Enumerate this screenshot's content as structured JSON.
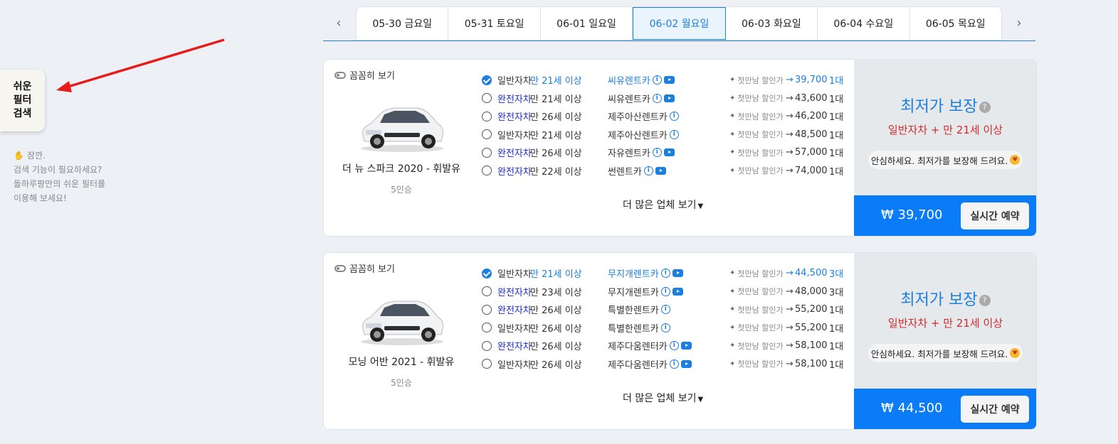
{
  "filter": {
    "label_lines": [
      "쉬운",
      "필터",
      "검색"
    ]
  },
  "hint": {
    "icon": "waving-hand-icon",
    "title": "잠깐.",
    "lines": [
      "검색 기능이 필요하세요?",
      "돌하루팡만의 쉬운 필터를",
      "이용해 보세요!"
    ]
  },
  "dates": {
    "prev_icon": "chevron-left-icon",
    "next_icon": "chevron-right-icon",
    "tabs": [
      "05-30 금요일",
      "05-31 토요일",
      "06-01 일요일",
      "06-02 월요일",
      "06-03 화요일",
      "06-04 수요일",
      "06-05 목요일"
    ],
    "active_index": 3
  },
  "common": {
    "detail_toggle": "꼼꼼히 보기",
    "more_label": "더 많은 업체 보기",
    "discount_label": "첫만남 할인가",
    "guarantee_title": "최저가 보장",
    "reassure_text": "안심하세요. 최저가를 보장해 드려요.",
    "book_label": "실시간 예약",
    "accent_color": "#0a7cf7",
    "red_color": "#d32b2b"
  },
  "cards": [
    {
      "car_name": "더 뉴 스파크 2020 - 휘발유",
      "seats": "5인승",
      "guarantee_sub": "일반자차 + 만 21세 이상",
      "price": "₩ 39,700",
      "rows": [
        {
          "insurance": "일반자차",
          "age": "만 21세 이상",
          "company": "씨유렌트카",
          "info": true,
          "video": true,
          "price": "39,700",
          "count": "1대",
          "selected": true
        },
        {
          "insurance": "완전자차",
          "age": "만 21세 이상",
          "company": "씨유렌트카",
          "info": true,
          "video": true,
          "price": "43,600",
          "count": "1대",
          "selected": false
        },
        {
          "insurance": "완전자차",
          "age": "만 26세 이상",
          "company": "제주아산렌트카",
          "info": true,
          "video": false,
          "price": "46,200",
          "count": "1대",
          "selected": false
        },
        {
          "insurance": "일반자차",
          "age": "만 21세 이상",
          "company": "제주아산렌트카",
          "info": true,
          "video": false,
          "price": "48,500",
          "count": "1대",
          "selected": false
        },
        {
          "insurance": "완전자차",
          "age": "만 26세 이상",
          "company": "자유렌트카",
          "info": true,
          "video": true,
          "price": "57,000",
          "count": "1대",
          "selected": false
        },
        {
          "insurance": "완전자차",
          "age": "만 22세 이상",
          "company": "썬렌트카",
          "info": true,
          "video": true,
          "price": "74,000",
          "count": "1대",
          "selected": false
        }
      ]
    },
    {
      "car_name": "모닝 어반 2021 - 휘발유",
      "seats": "5인승",
      "guarantee_sub": "일반자차 + 만 21세 이상",
      "price": "₩ 44,500",
      "rows": [
        {
          "insurance": "일반자차",
          "age": "만 21세 이상",
          "company": "무지개렌트카",
          "info": true,
          "video": true,
          "price": "44,500",
          "count": "3대",
          "selected": true
        },
        {
          "insurance": "완전자차",
          "age": "만 23세 이상",
          "company": "무지개렌트카",
          "info": true,
          "video": true,
          "price": "48,000",
          "count": "3대",
          "selected": false
        },
        {
          "insurance": "완전자차",
          "age": "만 26세 이상",
          "company": "특별한렌트카",
          "info": true,
          "video": false,
          "price": "55,200",
          "count": "1대",
          "selected": false
        },
        {
          "insurance": "일반자차",
          "age": "만 26세 이상",
          "company": "특별한렌트카",
          "info": true,
          "video": false,
          "price": "55,200",
          "count": "1대",
          "selected": false
        },
        {
          "insurance": "완전자차",
          "age": "만 26세 이상",
          "company": "제주다움렌터카",
          "info": true,
          "video": true,
          "price": "58,100",
          "count": "1대",
          "selected": false
        },
        {
          "insurance": "일반자차",
          "age": "만 26세 이상",
          "company": "제주다움렌터카",
          "info": true,
          "video": true,
          "price": "58,100",
          "count": "1대",
          "selected": false
        }
      ]
    }
  ]
}
